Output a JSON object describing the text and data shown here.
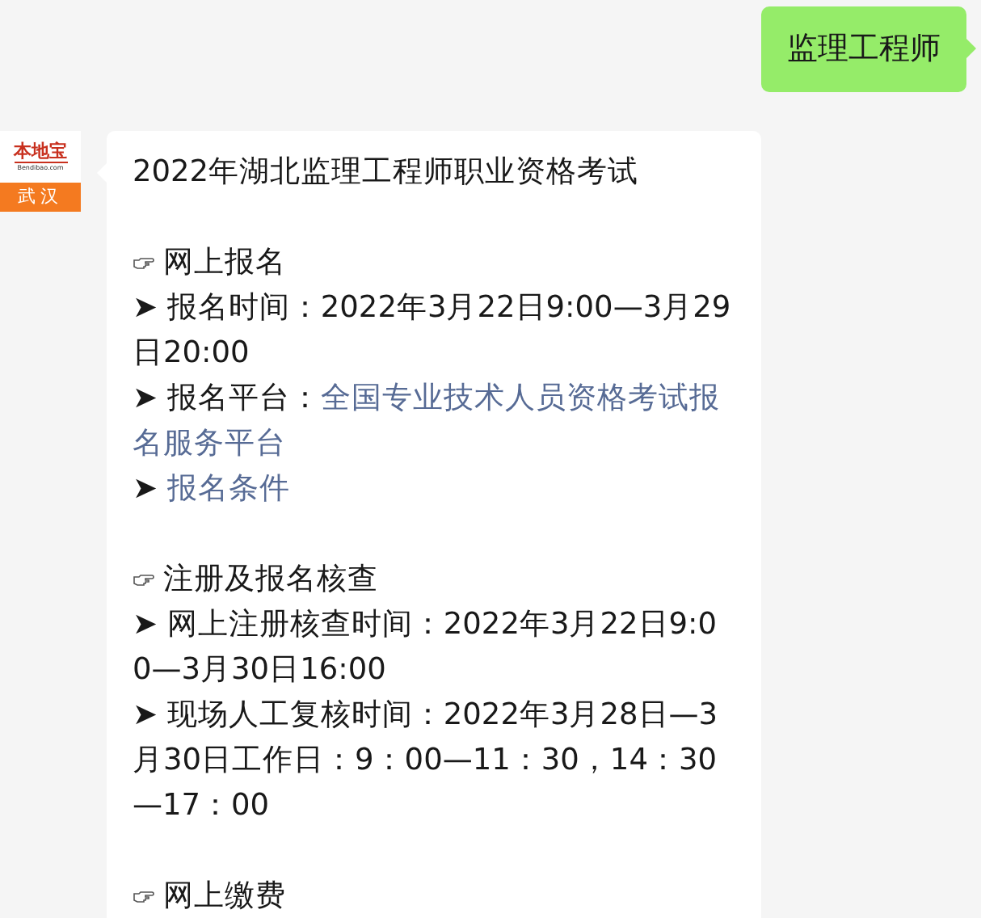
{
  "user_message": {
    "text": "监理工程师"
  },
  "bot_message": {
    "avatar": {
      "brand": "本地宝",
      "domain": "Bendibao.com",
      "city": "武汉"
    },
    "title": "2022年湖北监理工程师职业资格考试",
    "sections": [
      {
        "heading": "网上报名",
        "items": [
          {
            "kind": "text",
            "text": "➤ 报名时间：2022年3月22日9:00—3月29日20:00"
          },
          {
            "kind": "link",
            "prefix": "➤ 报名平台：",
            "link": "全国专业技术人员资格考试报名服务平台"
          },
          {
            "kind": "link",
            "prefix": "➤ ",
            "link": "报名条件"
          }
        ]
      },
      {
        "heading": "注册及报名核查",
        "items": [
          {
            "kind": "text",
            "text": "➤ 网上注册核查时间：2022年3月22日9:00—3月30日16:00"
          },
          {
            "kind": "text",
            "text": "➤ 现场人工复核时间：2022年3月28日—3月30日工作日：9：00—11：30，14：30—17：00"
          }
        ]
      },
      {
        "heading": "网上缴费"
      }
    ]
  }
}
